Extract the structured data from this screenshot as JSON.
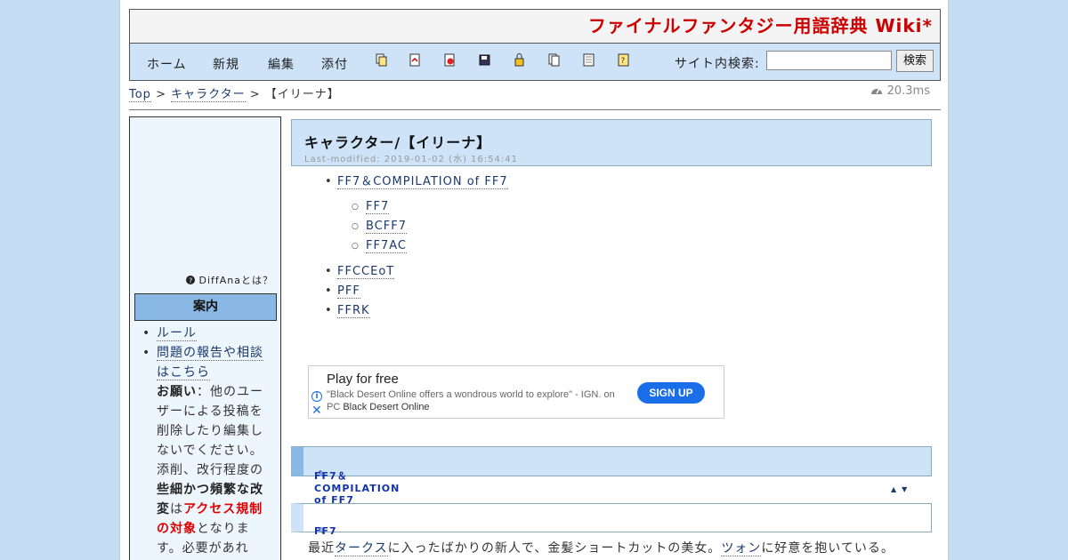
{
  "site": {
    "title": "ファイナルファンタジー用語辞典 Wiki*"
  },
  "nav": {
    "home": "ホーム",
    "new": "新規",
    "edit": "編集",
    "attach": "添付",
    "search_label": "サイト内検索:",
    "search_value": "",
    "search_button": "検索"
  },
  "breadcrumb": {
    "top": "Top",
    "sep1": " > ",
    "category": "キャラクター",
    "sep2": " > ",
    "current": "【イリーナ】"
  },
  "timing": "20.3ms",
  "sidebar": {
    "diffana": "DiffAnaとは？",
    "heading": "案内",
    "rule": "ルール",
    "report": "問題の報告や相談はこちら",
    "notice_bold1": "お願い",
    "notice_text1": "：他のユーザーによる投稿を削除したり編集しないでください。添削、改行程度の",
    "notice_bold2": "些細かつ頻繁な改変",
    "notice_text2": "は",
    "notice_red": "アクセス規制の対象",
    "notice_text3": "となります。必要があれ"
  },
  "page": {
    "title": "キャラクター/【イリーナ】",
    "modified": "Last-modified: 2019-01-02 (水) 16:54:41"
  },
  "toc": {
    "ff7_compilation": "FF7＆COMPILATION of FF7",
    "ff7": "FF7",
    "bcff7": "BCFF7",
    "ff7ac": "FF7AC",
    "ffcceot": "FFCCEoT",
    "pff": "PFF",
    "ffrk": "FFRK"
  },
  "ad": {
    "title": "Play for free",
    "desc": "\"Black Desert Online offers a wondrous world to explore\" - IGN. on PC",
    "advertiser": "Black Desert Online",
    "button": "SIGN UP",
    "info_glyph": "i",
    "close_glyph": "✕"
  },
  "sections": {
    "h2": "FF7＆COMPILATION of FF7",
    "h3": "FF7",
    "arrows": "▲▼",
    "body_pre": "最近",
    "body_link1": "タークス",
    "body_mid": "に入ったばかりの新人で、金髪ショートカットの美女。",
    "body_link2": "ツォン",
    "body_post": "に好意を抱いている。"
  },
  "icons": [
    "copy-page-icon",
    "diff-icon",
    "backup-icon",
    "save-icon",
    "freeze-icon",
    "list-icon",
    "recent-icon",
    "help-icon"
  ]
}
